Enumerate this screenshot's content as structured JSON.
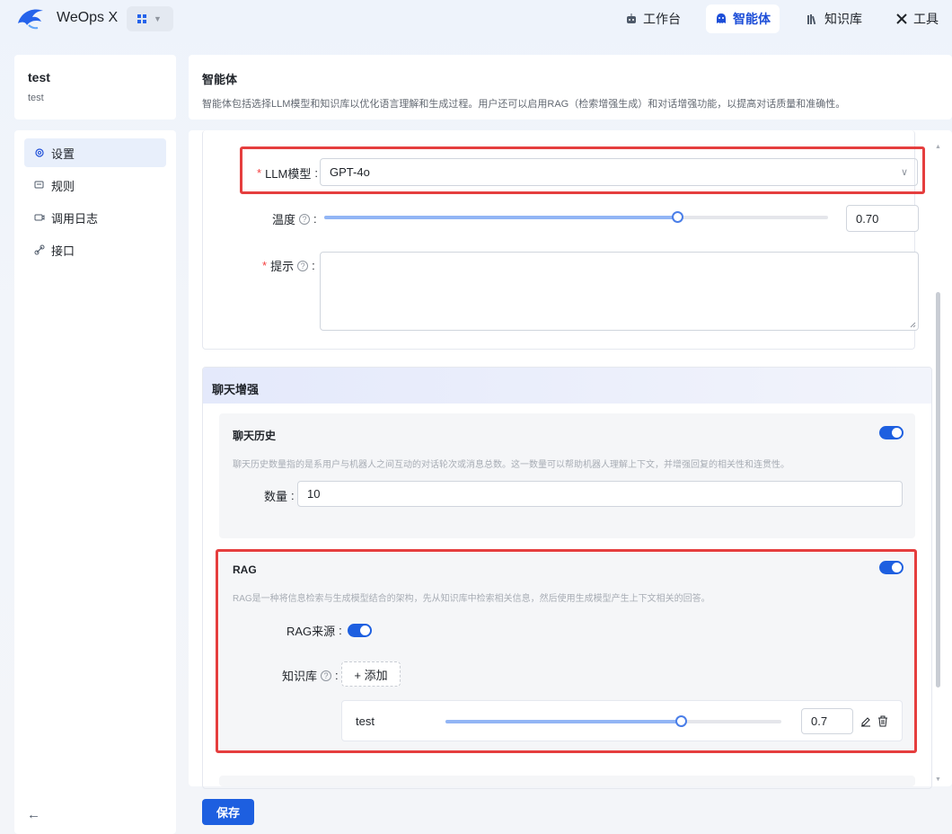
{
  "header": {
    "app_title": "WeOps X",
    "nav": [
      {
        "label": "工作台",
        "icon": "robot-icon"
      },
      {
        "label": "智能体",
        "icon": "bot-icon"
      },
      {
        "label": "知识库",
        "icon": "books-icon"
      },
      {
        "label": "工具",
        "icon": "tools-icon"
      }
    ]
  },
  "agent": {
    "name": "test",
    "description": "test"
  },
  "sidebar": {
    "items": [
      {
        "label": "设置",
        "icon": "gear-icon"
      },
      {
        "label": "规则",
        "icon": "rule-icon"
      },
      {
        "label": "调用日志",
        "icon": "log-icon"
      },
      {
        "label": "接口",
        "icon": "link-icon"
      }
    ],
    "back_icon": "←"
  },
  "page": {
    "title": "智能体",
    "description": "智能体包括选择LLM模型和知识库以优化语言理解和生成过程。用户还可以启用RAG（检索增强生成）和对话增强功能，以提高对话质量和准确性。"
  },
  "form": {
    "llm_label": "LLM模型",
    "llm_value": "GPT-4o",
    "temperature_label": "温度",
    "temperature_value": "0.70",
    "temperature_fraction": 0.7,
    "prompt_label": "提示",
    "prompt_value": ""
  },
  "chat_enhance": {
    "title": "聊天增强",
    "history": {
      "title": "聊天历史",
      "desc": "聊天历史数量指的是系用户与机器人之间互动的对话轮次或消息总数。这一数量可以帮助机器人理解上下文，并增强回复的相关性和连贯性。",
      "count_label": "数量",
      "count_value": "10",
      "enabled": true
    },
    "rag": {
      "title": "RAG",
      "desc": "RAG是一种将信息检索与生成模型结合的架构，先从知识库中检索相关信息，然后使用生成模型产生上下文相关的回答。",
      "source_label": "RAG来源",
      "kb_label": "知识库",
      "add_label": "+ 添加",
      "enabled": true,
      "source_enabled": true,
      "kb_items": [
        {
          "name": "test",
          "score": "0.7",
          "fraction": 0.7
        }
      ]
    }
  },
  "actions": {
    "save_label": "保存"
  },
  "colors": {
    "accent": "#1d5fe0",
    "highlight_box": "#e53e3e",
    "required": "#f53f3f"
  }
}
